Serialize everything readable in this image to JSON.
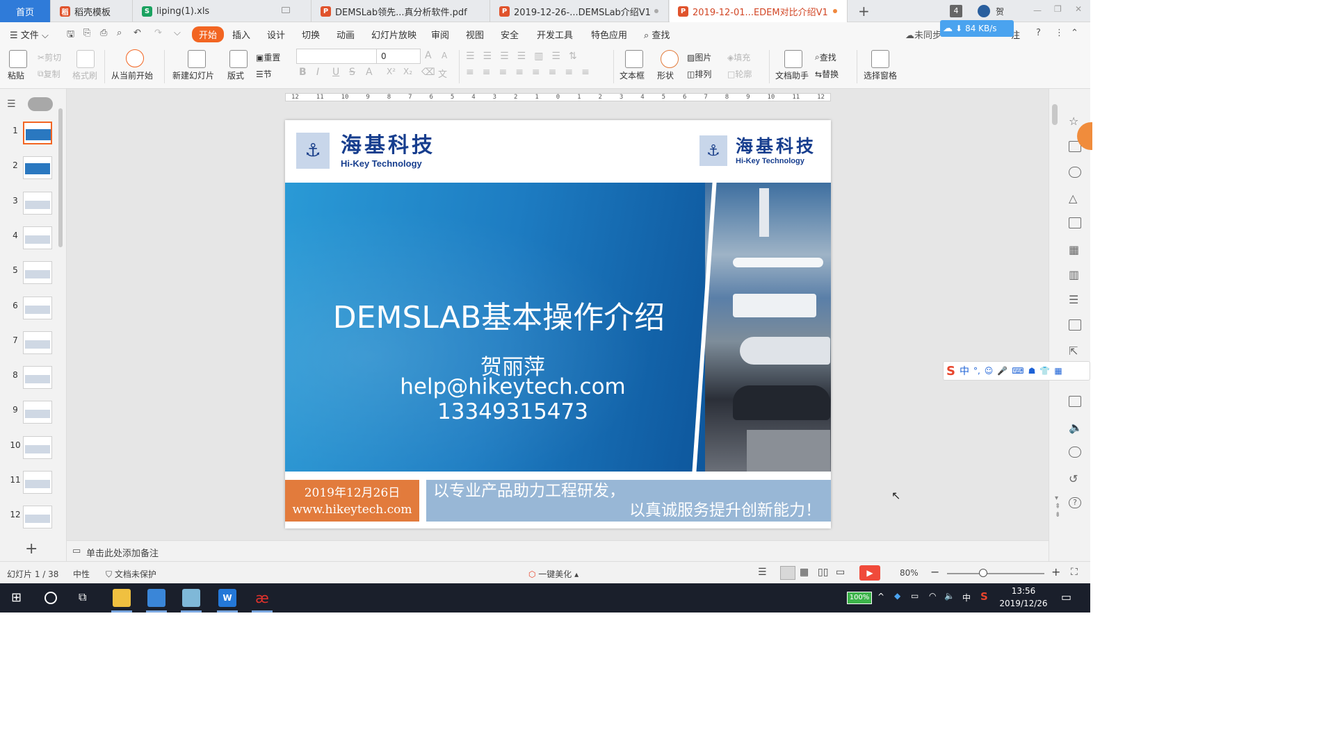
{
  "tabs": [
    {
      "label": "首页",
      "kind": "home"
    },
    {
      "label": "稻壳模板",
      "icon": "docer-icon",
      "color": "#e0532c"
    },
    {
      "label": "liping(1).xls",
      "icon": "spreadsheet-icon",
      "color": "#1aa260"
    },
    {
      "label": "DEMSLab领先...真分析软件.pdf",
      "icon": "pdf-icon",
      "color": "#e0532c"
    },
    {
      "label": "2019-12-26-...DEMSLab介绍V1",
      "icon": "presentation-icon",
      "color": "#e0532c"
    },
    {
      "label": "2019-12-01...EDEM对比介绍V1",
      "icon": "presentation-icon",
      "color": "#e0532c"
    }
  ],
  "tabbar_right": {
    "badge": "4",
    "user": "贺"
  },
  "menu": {
    "file": "文件",
    "items": [
      "开始",
      "插入",
      "设计",
      "切换",
      "动画",
      "幻灯片放映",
      "审阅",
      "视图",
      "安全",
      "开发工具",
      "特色应用"
    ],
    "active": "开始",
    "search": "查找",
    "sync": "未同步",
    "netspeed": "84 KB/s",
    "annot": "注"
  },
  "ribbon": {
    "paste": "粘贴",
    "cut": "剪切",
    "copy": "复制",
    "format_painter": "格式刷",
    "from_current": "从当前开始",
    "new_slide": "新建幻灯片",
    "layout": "版式",
    "reset": "重置",
    "section": "节",
    "font_size": "0",
    "textbox": "文本框",
    "shape": "形状",
    "picture": "图片",
    "fill": "填充",
    "arrange": "排列",
    "outline": "轮廓",
    "doc_assistant": "文档助手",
    "find": "查找",
    "replace": "替换",
    "select_pane": "选择窗格"
  },
  "ruler": [
    "12",
    "11",
    "10",
    "9",
    "8",
    "7",
    "6",
    "5",
    "4",
    "3",
    "2",
    "1",
    "0",
    "1",
    "2",
    "3",
    "4",
    "5",
    "6",
    "7",
    "8",
    "9",
    "10",
    "11",
    "12"
  ],
  "slides": [
    "1",
    "2",
    "3",
    "4",
    "5",
    "6",
    "7",
    "8",
    "9",
    "10",
    "11",
    "12"
  ],
  "current_slide": 1,
  "slide": {
    "logo_cn": "海基科技",
    "logo_en": "Hi-Key Technology",
    "title": "DEMSLAB基本操作介绍",
    "presenter": "贺丽萍",
    "email": "help@hikeytech.com",
    "phone": "13349315473",
    "date": "2019年12月26日",
    "website": "www.hikeytech.com",
    "slogan_1": "以专业产品助力工程研发，",
    "slogan_2": "以真诚服务提升创新能力！",
    "colors": {
      "banner": "#1d7cc2",
      "date_box": "#e27b3c",
      "slogan_box": "#98b7d6",
      "logo": "#173e8e"
    }
  },
  "notes_placeholder": "单击此处添加备注",
  "status": {
    "slide_pos": "幻灯片 1 / 38",
    "theme": "中性",
    "protection": "文档未保护",
    "beautify": "一键美化",
    "zoom": "80%"
  },
  "ime": {
    "lang": "中"
  },
  "taskbar": {
    "battery": "100%",
    "lang": "中",
    "time": "13:56",
    "date": "2019/12/26"
  }
}
